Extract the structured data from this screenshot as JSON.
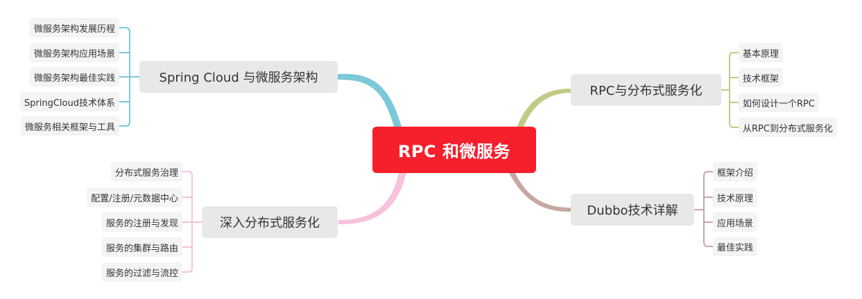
{
  "root": {
    "label": "RPC 和微服务",
    "color": "#f61f2c"
  },
  "branches": {
    "spring": {
      "label": "Spring Cloud 与微服务架构",
      "color": "#7bc8d8",
      "children": [
        "微服务架构发展历程",
        "微服务架构应用场景",
        "微服务架构最佳实践",
        "SpringCloud技术体系",
        "微服务相关框架与工具"
      ]
    },
    "deep": {
      "label": "深入分布式服务化",
      "color": "#f8c1dc",
      "children": [
        "分布式服务治理",
        "配置/注册/元数据中心",
        "服务的注册与发现",
        "服务的集群与路由",
        "服务的过滤与流控"
      ]
    },
    "rpc": {
      "label": "RPC与分布式服务化",
      "color": "#c4c985",
      "children": [
        "基本原理",
        "技术框架",
        "如何设计一个RPC",
        "从RPC到分布式服务化"
      ]
    },
    "dubbo": {
      "label": "Dubbo技术详解",
      "color": "#c6a8a1",
      "children": [
        "框架介绍",
        "技术原理",
        "应用场景",
        "最佳实践"
      ]
    }
  }
}
